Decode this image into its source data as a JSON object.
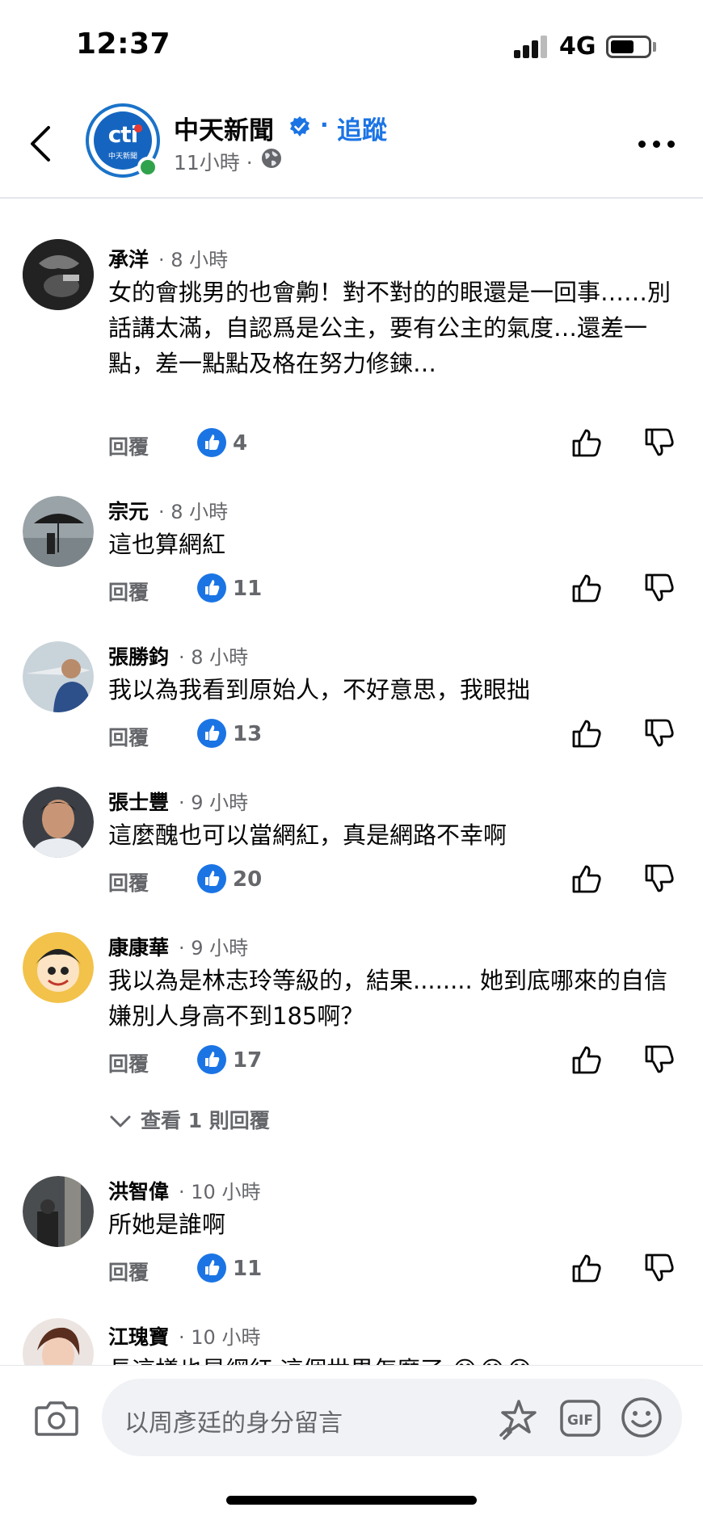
{
  "status_bar": {
    "time": "12:37",
    "network": "4G"
  },
  "header": {
    "page_name": "中天新聞",
    "separator": "·",
    "follow_label": "追蹤",
    "post_time": "11小時 ·",
    "avatar_logo_text": "cti",
    "avatar_logo_subtext": "中天新聞"
  },
  "comments": [
    {
      "name": "承洋",
      "time": "· 8 小時",
      "text": "女的會挑男的也會齁！對不對的的眼還是一回事……別話講太滿，自認爲是公主，要有公主的氣度…還差一點，差一點點及格在努力修鍊…",
      "reply_label": "回覆",
      "likes": "4"
    },
    {
      "name": "宗元",
      "time": "· 8 小時",
      "text": "這也算網紅",
      "reply_label": "回覆",
      "likes": "11"
    },
    {
      "name": "張勝鈞",
      "time": "· 8 小時",
      "text": "我以為我看到原始人，不好意思，我眼拙",
      "reply_label": "回覆",
      "likes": "13"
    },
    {
      "name": "張士豐",
      "time": "· 9 小時",
      "text": "這麼醜也可以當網紅，真是網路不幸啊",
      "reply_label": "回覆",
      "likes": "20"
    },
    {
      "name": "康康華",
      "time": "· 9 小時",
      "text": "我以為是林志玲等級的，結果........ 她到底哪來的自信嫌別人身高不到185啊？",
      "reply_label": "回覆",
      "likes": "17",
      "view_replies": "查看 1 則回覆"
    },
    {
      "name": "洪智偉",
      "time": "· 10 小時",
      "text": "所她是誰啊",
      "reply_label": "回覆",
      "likes": "11"
    },
    {
      "name": "江瑰寶",
      "time": "· 10 小時",
      "text": "長這樣也是網紅 這個世界怎麼了 😂😂😂"
    }
  ],
  "composer": {
    "placeholder": "以周彥廷的身分留言",
    "gif_label": "GIF"
  },
  "colors": {
    "accent": "#1b74e4",
    "secondary_text": "#65676b",
    "online": "#31a24c"
  }
}
